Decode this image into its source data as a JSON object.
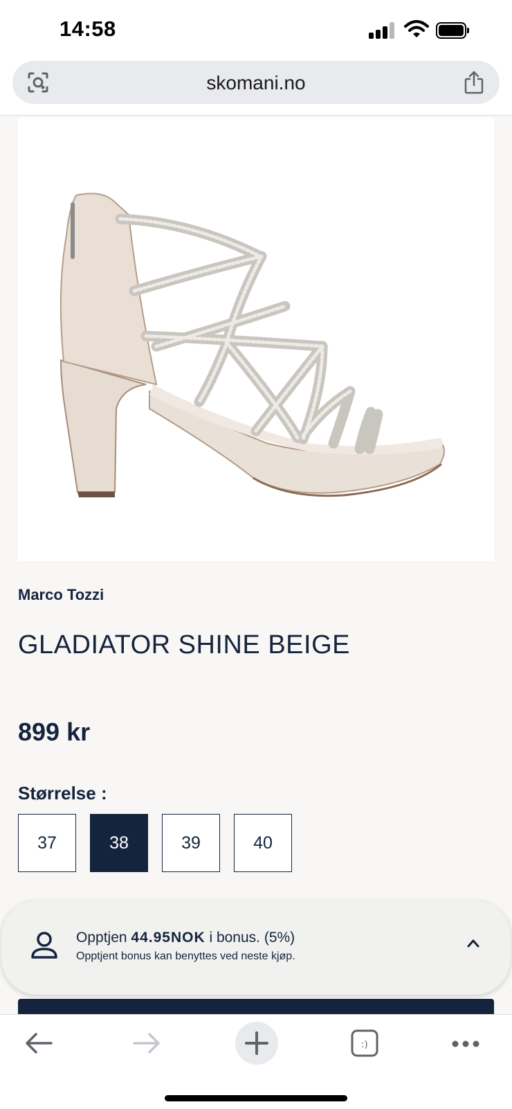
{
  "status_bar": {
    "time": "14:58"
  },
  "browser": {
    "url": "skomani.no"
  },
  "product": {
    "brand": "Marco Tozzi",
    "name": "GLADIATOR SHINE BEIGE",
    "price": "899 kr",
    "size_label": "Størrelse :",
    "sizes": [
      "37",
      "38",
      "39",
      "40"
    ],
    "selected_size": "38"
  },
  "bonus": {
    "prefix": "Opptjen ",
    "amount": "44.95NOK",
    "suffix": " i bonus. (5%)",
    "note": "Opptjent bonus kan benyttes ved neste kjøp."
  },
  "colors": {
    "navy": "#15243d",
    "background": "#f9f7f6",
    "sandal": "#e6dbd0"
  },
  "icons": [
    "lens-icon",
    "share-icon",
    "user-icon",
    "chevron-up-icon",
    "back-arrow-icon",
    "forward-arrow-icon",
    "plus-icon",
    "tabs-icon",
    "more-icon"
  ]
}
